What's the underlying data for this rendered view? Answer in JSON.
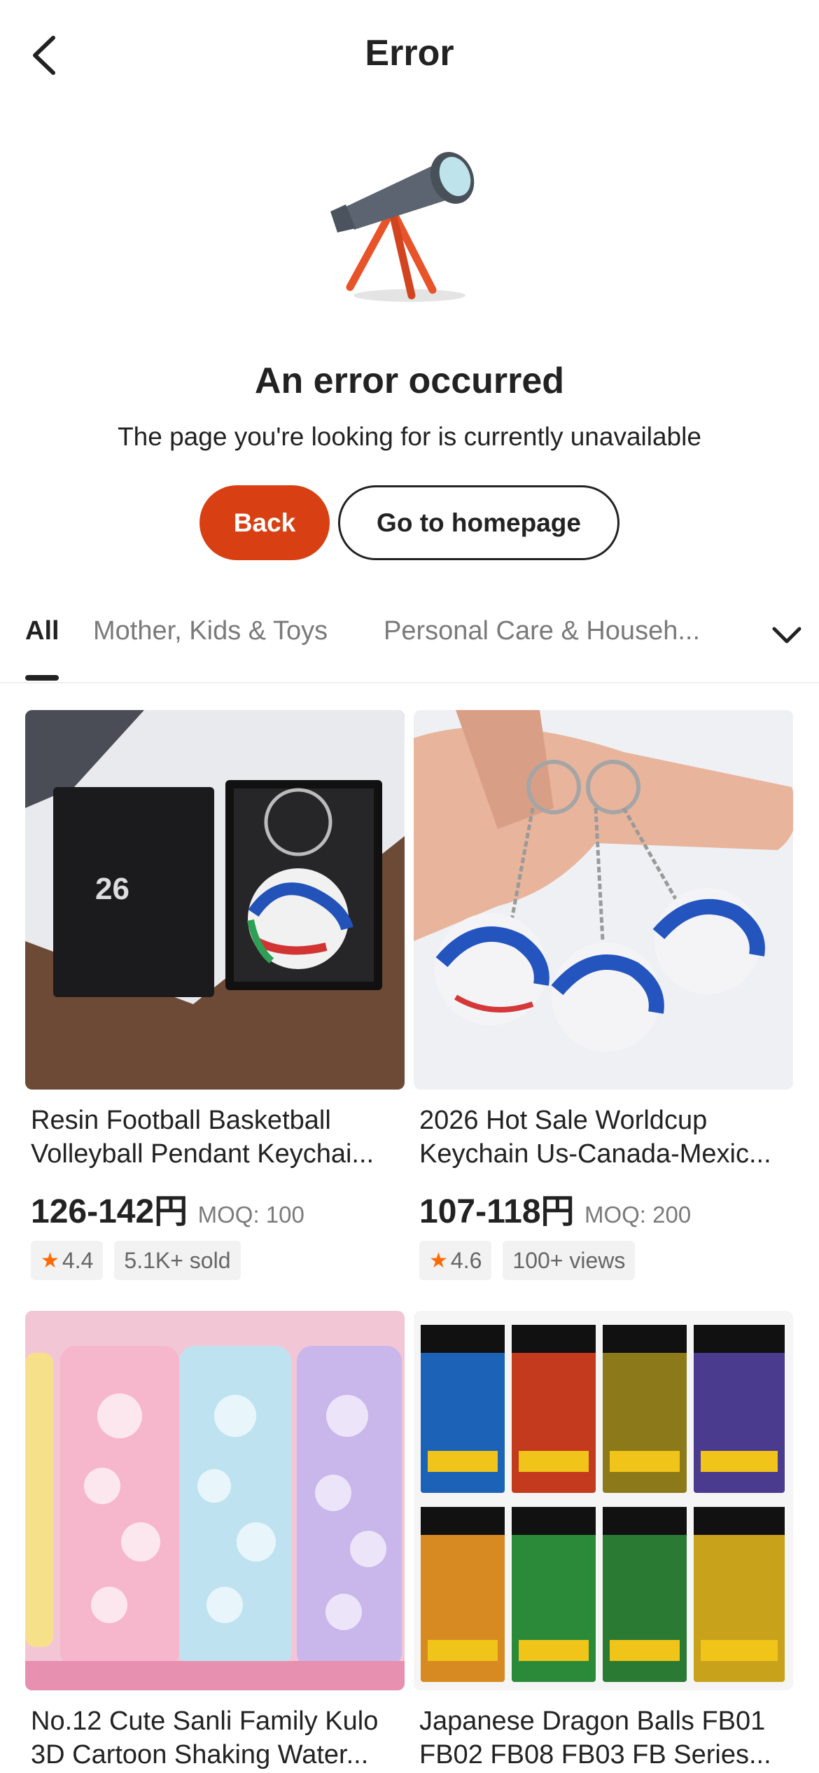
{
  "header": {
    "title": "Error",
    "back_icon": "chevron-left-icon"
  },
  "error": {
    "illustration": "telescope-illustration",
    "heading": "An error occurred",
    "message": "The page you're looking for is currently unavailable",
    "back_label": "Back",
    "home_label": "Go to homepage"
  },
  "tabs": {
    "items": [
      {
        "label": "All",
        "active": true
      },
      {
        "label": "Mother, Kids & Toys",
        "active": false
      },
      {
        "label": "Personal Care & Househ...",
        "active": false
      }
    ],
    "expand_icon": "chevron-down-icon"
  },
  "products": [
    {
      "title_line1": "Resin Football Basketball",
      "title_line2": "Volleyball Pendant Keychai...",
      "price": "126-142円",
      "moq": "MOQ: 100",
      "rating": "4.4",
      "stat": "5.1K+ sold"
    },
    {
      "title_line1": "2026 Hot Sale Worldcup",
      "title_line2": "Keychain Us-Canada-Mexic...",
      "price": "107-118円",
      "moq": "MOQ: 200",
      "rating": "4.6",
      "stat": "100+ views"
    },
    {
      "title_line1": "No.12 Cute Sanli Family Kulo",
      "title_line2": "3D Cartoon Shaking Water..."
    },
    {
      "title_line1": "Japanese Dragon Balls FB01",
      "title_line2": "FB02 FB08 FB03 FB Series..."
    }
  ],
  "colors": {
    "primary": "#d84013",
    "star": "#ff6a00",
    "muted": "#7a7a7a"
  }
}
